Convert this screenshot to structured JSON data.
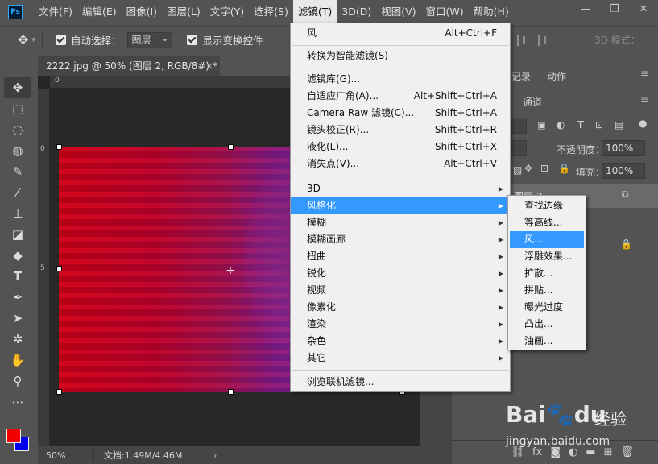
{
  "app": {
    "logo": "Ps"
  },
  "menubar": {
    "items": [
      "文件(F)",
      "编辑(E)",
      "图像(I)",
      "图层(L)",
      "文字(Y)",
      "选择(S)",
      "滤镜(T)",
      "3D(D)",
      "视图(V)",
      "窗口(W)",
      "帮助(H)"
    ],
    "active": "滤镜(T)"
  },
  "window_controls": {
    "minimize": "—",
    "restore": "❐",
    "close": "✕"
  },
  "options": {
    "auto_select_label": "自动选择：",
    "auto_select_value": "图层",
    "show_transform_label": "显示变换控件",
    "mode_3d": "3D 模式："
  },
  "document": {
    "tab_title": "2222.jpg @ 50% (图层 2, RGB/8#) *",
    "tab_close": "×",
    "zoom": "50%",
    "doc_size": "文档:1.49M/4.46M",
    "ruler_zero_top": "0",
    "ruler_zero_left": "0",
    "ruler_mark_5": "5"
  },
  "filter_menu": {
    "items": [
      {
        "label": "风",
        "shortcut": "Alt+Ctrl+F"
      },
      {
        "label": "转换为智能滤镜(S)",
        "shortcut": ""
      },
      {
        "label": "滤镜库(G)...",
        "shortcut": ""
      },
      {
        "label": "自适应广角(A)...",
        "shortcut": "Alt+Shift+Ctrl+A"
      },
      {
        "label": "Camera Raw 滤镜(C)...",
        "shortcut": "Shift+Ctrl+A"
      },
      {
        "label": "镜头校正(R)...",
        "shortcut": "Shift+Ctrl+R"
      },
      {
        "label": "液化(L)...",
        "shortcut": "Shift+Ctrl+X"
      },
      {
        "label": "消失点(V)...",
        "shortcut": "Alt+Ctrl+V"
      },
      {
        "label": "3D",
        "shortcut": ""
      },
      {
        "label": "风格化",
        "shortcut": ""
      },
      {
        "label": "模糊",
        "shortcut": ""
      },
      {
        "label": "模糊画廊",
        "shortcut": ""
      },
      {
        "label": "扭曲",
        "shortcut": ""
      },
      {
        "label": "锐化",
        "shortcut": ""
      },
      {
        "label": "视频",
        "shortcut": ""
      },
      {
        "label": "像素化",
        "shortcut": ""
      },
      {
        "label": "渲染",
        "shortcut": ""
      },
      {
        "label": "杂色",
        "shortcut": ""
      },
      {
        "label": "其它",
        "shortcut": ""
      },
      {
        "label": "浏览联机滤镜...",
        "shortcut": ""
      }
    ],
    "highlighted": "风格化",
    "submenu_arrow": "▶"
  },
  "stylize_submenu": {
    "items": [
      "查找边缘",
      "等高线...",
      "风...",
      "浮雕效果...",
      "扩散...",
      "拼贴...",
      "曝光过度",
      "凸出...",
      "油画..."
    ],
    "highlighted": "风..."
  },
  "panels": {
    "history_tab": "记录",
    "actions_tab": "动作",
    "channels_tab": "通道",
    "opacity_label": "不透明度：",
    "opacity_value": "100%",
    "fill_label": "填充：",
    "fill_value": "100%",
    "layer_name": "图层 2",
    "fx_label": "fx"
  },
  "watermark": {
    "logo_text": "Bai🐾du",
    "brand": "经验",
    "url": "jingyan.baidu.com"
  },
  "colors": {
    "foreground": "#f20000",
    "background": "#0000ee",
    "menu_highlight": "#3399ff"
  }
}
